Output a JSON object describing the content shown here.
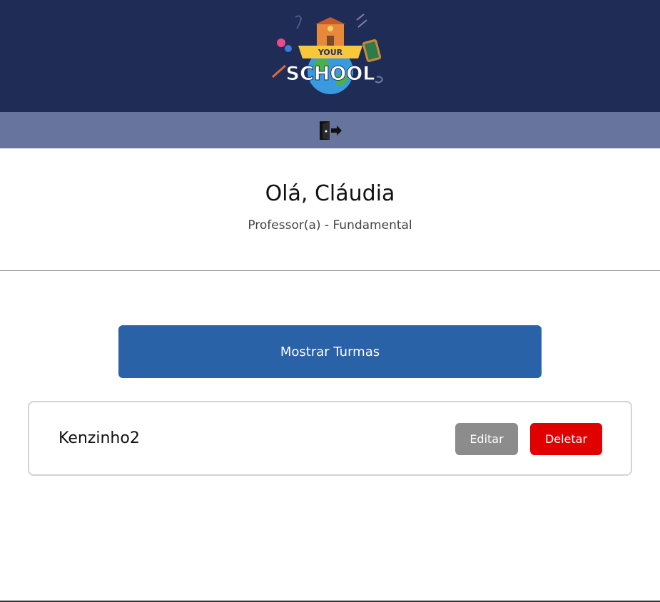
{
  "header": {
    "logo_text": {
      "top": "YOUR",
      "bottom": "SCHOOL"
    }
  },
  "nav": {
    "logout_icon": "door-exit-icon"
  },
  "profile": {
    "greeting": "Olá, Cláudia",
    "role": "Professor(a) - Fundamental"
  },
  "actions": {
    "show_classes_label": "Mostrar Turmas"
  },
  "classes": [
    {
      "name": "Kenzinho2",
      "edit_label": "Editar",
      "delete_label": "Deletar"
    }
  ],
  "colors": {
    "header_bg": "#1f2d56",
    "subbar_bg": "#67749d",
    "primary": "#2962a6",
    "edit": "#8c8c8c",
    "delete": "#e00000"
  }
}
